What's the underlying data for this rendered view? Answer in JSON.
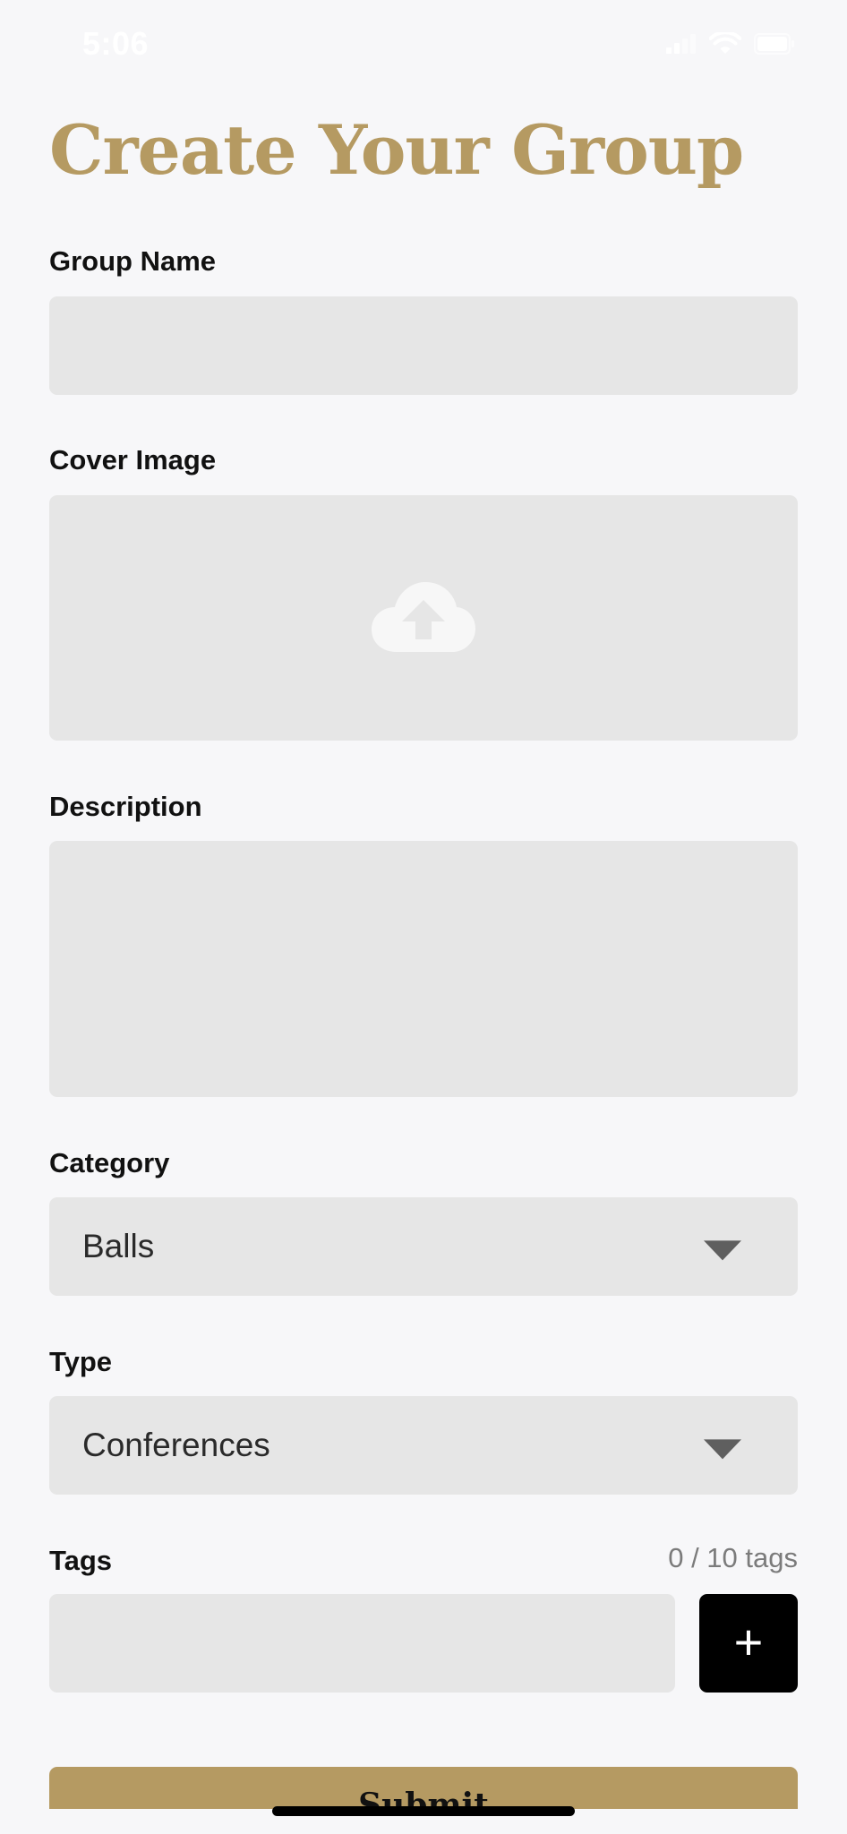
{
  "status_bar": {
    "time": "5:06"
  },
  "page": {
    "title": "Create Your Group"
  },
  "form": {
    "group_name": {
      "label": "Group Name",
      "value": ""
    },
    "cover_image": {
      "label": "Cover Image",
      "icon": "cloud-upload-icon"
    },
    "description": {
      "label": "Description",
      "value": ""
    },
    "category": {
      "label": "Category",
      "selected": "Balls",
      "icon": "chevron-down-icon"
    },
    "type": {
      "label": "Type",
      "selected": "Conferences",
      "icon": "chevron-down-icon"
    },
    "tags": {
      "label": "Tags",
      "counter": "0 / 10 tags",
      "value": "",
      "add_icon": "plus-icon",
      "add_symbol": "+"
    },
    "submit_label": "Submit"
  },
  "colors": {
    "accent": "#b59a62",
    "field_bg": "#e6e6e6",
    "page_bg": "#f7f7f9"
  }
}
